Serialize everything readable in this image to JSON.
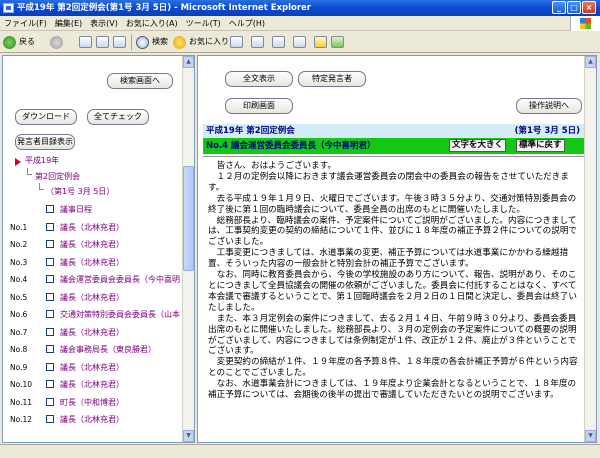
{
  "window": {
    "title": "平成19年 第2回定例会(第1号 3月 5日) - Microsoft Internet Explorer"
  },
  "menu": [
    "ファイル(F)",
    "編集(E)",
    "表示(V)",
    "お気に入り(A)",
    "ツール(T)",
    "ヘルプ(H)"
  ],
  "toolbar": {
    "back": "戻る",
    "search": "検索",
    "favorites": "お気に入り"
  },
  "left": {
    "search_screen": "検索画面へ",
    "download": "ダウンロード",
    "check_all": "全てチェック",
    "show_speakers": "発言者目録表示",
    "tree": {
      "year": "平成19年",
      "session": "第2回定例会",
      "issue": "（第1号 3月 5日）"
    },
    "items": [
      {
        "no": "",
        "label": "議事日程"
      },
      {
        "no": "No.1",
        "label": "議長（北林充君）"
      },
      {
        "no": "No.2",
        "label": "議長（北林充君）"
      },
      {
        "no": "No.3",
        "label": "議長（北林充君）"
      },
      {
        "no": "No.4",
        "label": "議会運営委員会委員長（今中喜明"
      },
      {
        "no": "No.5",
        "label": "議長（北林充君）"
      },
      {
        "no": "No.6",
        "label": "交通対策特別委員会委員長（山本"
      },
      {
        "no": "No.7",
        "label": "議長（北林充君）"
      },
      {
        "no": "No.8",
        "label": "議会事務局長（東良勝君）"
      },
      {
        "no": "No.9",
        "label": "議長（北林充君）"
      },
      {
        "no": "No.10",
        "label": "議長（北林充君）"
      },
      {
        "no": "No.11",
        "label": "町長（中和博君）"
      },
      {
        "no": "No.12",
        "label": "議長（北林充君）"
      }
    ]
  },
  "right": {
    "show_all": "全文表示",
    "specific_speaker": "特定発言者",
    "print_screen": "印刷画面",
    "help": "操作説明へ",
    "header_title": "平成19年 第2回定例会",
    "header_date": "(第1号 3月 5日)",
    "speaker": "No.4 議会運営委員会委員長（今中喜明君）",
    "text_bigger": "文字を大きく",
    "text_normal": "標準に戻す",
    "paragraphs": [
      "皆さん、おはようございます。",
      "１２月の定例会以降におきます議会運営委員会の閉会中の委員会の報告をさせていただきます。",
      "去る平成１９年１月９日、火曜日でございます。午後３時３５分より、交通対策特別委員会の終了後に第１回の臨時議会について、委員全員の出席のもとに開催いたしました。",
      "総務部長より、臨時議会の案件、予定案件についてご説明がございました。内容につきましては、工事契約変更の契約の締結について１件、並びに１８年度の補正予算２件についての説明でございました。",
      "工事変更につきましては、水道事業の変更、補正予算については水道事業にかかわる繰越措置、そういった内容の一般会計と特別会計の補正予算でございます。",
      "なお、同時に教育委員会から、今後の学校施設のあり方について、報告、説明があり、そのことにつきまして全員協議会の開催の依頼がございました。委員会に付託することはなく、すべて本会議で審議するということで、第１回臨時議会を２月２日の１日間と決定し、委員会は終了いたしました。",
      "また、本３月定例会の案件につきまして、去る２月１４日、午前９時３０分より、委員会委員出席のもとに開催いたしました。総務部長より、３月の定例会の予定案件についての概要の説明がございまして、内容につきましては条例制定が１件、改正が１２件、廃止が３件ということでございます。",
      "変更契約の締結が１件、１９年度の各予算８件、１８年度の各会計補正予算が６件という内容とのことでございました。",
      "なお、水道事業会計につきましては、１９年度より企業会計となるということで、１８年度の補正予算については、会期後の後半の提出で審議していただきたいとの説明でございます。"
    ]
  },
  "colors": {
    "header_bg": "#d4ecf8",
    "speaker_bg": "#12c812",
    "link": "#800080",
    "accent": "#000080"
  }
}
